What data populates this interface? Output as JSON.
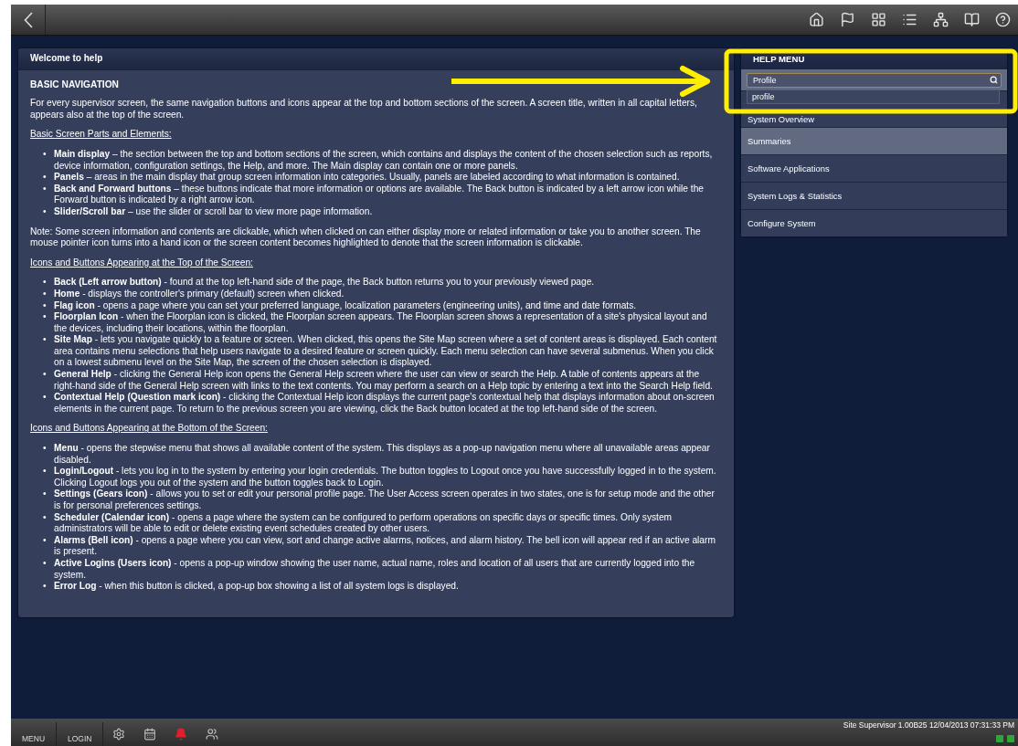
{
  "help_panel": {
    "title": "Welcome to help",
    "heading": "BASIC NAVIGATION",
    "blocks": [
      {
        "kind": "paragraph",
        "text": "For every supervisor screen, the same navigation buttons and icons appear at the top and bottom sections of the screen. A screen title, written in all capital letters, appears also at the top of the screen."
      },
      {
        "kind": "subheading",
        "text": "Basic Screen Parts and Elements:"
      },
      {
        "kind": "list",
        "marker": "•",
        "items": [
          "**Main display** – the section between the top and bottom sections of the screen, which contains and displays the content of the chosen selection such as reports, device information, configuration settings, the Help, and more. The Main display can contain one or more panels.",
          "**Panels** – areas in the main display that group screen information into categories. Usually, panels are labeled according to what information is contained.",
          "**Back and Forward buttons** – these buttons indicate that more information or options are available. The Back button is indicated by a left arrow icon while the Forward button is indicated by a right arrow icon.",
          "**Slider/Scroll bar** – use the slider or scroll bar to view more page information."
        ]
      },
      {
        "kind": "paragraph",
        "text": "Note: Some screen information and contents are clickable, which when clicked on can either display more or related information or take you to another screen. The mouse pointer icon turns into a hand icon or the screen content becomes highlighted to denote that the screen information is clickable."
      },
      {
        "kind": "subheading",
        "text": "Icons and Buttons Appearing at the Top of the Screen:"
      },
      {
        "kind": "list",
        "marker": "•",
        "items": [
          "**Back (Left arrow button)** - found at the top left-hand side of the page, the Back button returns you to your previously viewed page.",
          "**Home** - displays the controller's primary (default) screen when clicked.",
          "**Flag icon** - opens a page where you can set your preferred language, localization parameters (engineering units), and time and date formats.",
          "**Floorplan Icon** - when the Floorplan icon is clicked, the Floorplan screen appears. The Floorplan screen shows a representation of a site's physical layout and the devices, including their locations, within the floorplan.",
          "**Site Map** - lets you navigate quickly to a feature or screen. When clicked, this opens the Site Map screen where a set of content areas is displayed. Each content area contains menu selections that help users navigate to a desired feature or screen quickly. Each menu selection can have several submenus. When you click on a lowest submenu level on the Site Map, the screen of the chosen selection is displayed.",
          "**General Help** - clicking the General Help icon opens the General Help screen where the user can view or search the Help. A table of contents appears at the right-hand side of the General Help screen with links to the text contents. You may perform a search on a Help topic by entering a text into the Search Help field.",
          "**Contextual Help (Question mark icon)** - clicking the Contextual Help icon displays the current page's contextual help that displays information about on-screen elements in the current page. To return to the previous screen you are viewing, click the Back button located at the top left-hand side of the screen."
        ]
      },
      {
        "kind": "subheading",
        "text": "Icons and Buttons Appearing at the Bottom of the Screen:"
      },
      {
        "kind": "list",
        "marker": "•",
        "items": [
          "**Menu** - opens the stepwise menu that shows all available content of the system. This displays as a pop-up navigation menu where all unavailable areas appear disabled.",
          "**Login/Logout** - lets you log in to the system by entering your login credentials. The button toggles to Logout once you have successfully logged in to the system. Clicking Logout logs you out of the system and the button toggles back to Login.",
          "**Settings (Gears icon)** - allows you to set or edit your personal profile page. The User Access screen operates in two states, one is for setup mode and the other is for personal preferences settings.",
          "**Scheduler (Calendar icon)** - opens a page where the system can be configured to perform operations on specific days or specific times. Only system administrators will be able to edit or delete existing event schedules created by other users.",
          "**Alarms (Bell icon)** - opens a page where you can view, sort and change active alarms, notices, and alarm history. The bell icon will appear red if an active alarm is present.",
          "**Active Logins (Users icon)** - opens a pop-up window showing the user name, actual name, roles and location of all users that are currently logged into the system.",
          "**Error Log** - when this button is clicked, a pop-up box showing a list of all system logs is displayed."
        ]
      }
    ]
  },
  "help_menu": {
    "title": "HELP MENU",
    "search": {
      "value": "Profile"
    },
    "suggestions": [
      "profile"
    ],
    "items": [
      {
        "label": "System Overview",
        "selected": false
      },
      {
        "label": "Summaries",
        "selected": true
      },
      {
        "label": "Software Applications",
        "selected": false
      },
      {
        "label": "System Logs & Statistics",
        "selected": false
      },
      {
        "label": "Configure System",
        "selected": false
      }
    ]
  },
  "bottom_bar": {
    "buttons": [
      "MENU",
      "LOGIN"
    ],
    "icons": [
      {
        "kind": "settings",
        "alarm": false
      },
      {
        "kind": "calendar",
        "alarm": false
      },
      {
        "kind": "bell",
        "alarm": true
      },
      {
        "kind": "users",
        "alarm": false
      }
    ],
    "status": "Site Supervisor 1.00B25 12/04/2013 07:31:33 PM",
    "indicators": [
      {
        "color": "#2fa53a"
      },
      {
        "color": "#2fa53a"
      }
    ]
  }
}
